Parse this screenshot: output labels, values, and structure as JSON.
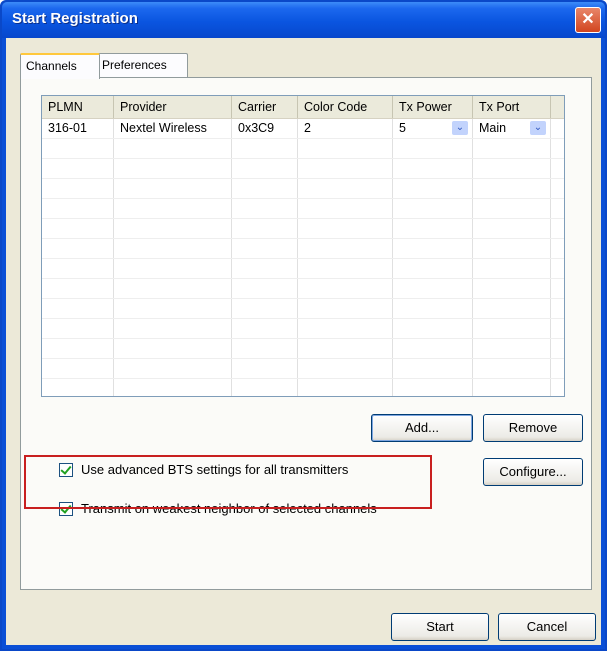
{
  "window": {
    "title": "Start Registration",
    "close_glyph": "✕"
  },
  "tabs": [
    {
      "label": "Channels",
      "active": true
    },
    {
      "label": "Preferences",
      "active": false
    }
  ],
  "table": {
    "columns": [
      "PLMN",
      "Provider",
      "Carrier",
      "Color Code",
      "Tx Power",
      "Tx Port"
    ],
    "rows": [
      [
        "316-01",
        "Nextel Wireless",
        "0x3C9",
        "2",
        "5",
        "Main"
      ]
    ],
    "dropdown_glyph": "⌄"
  },
  "buttons": {
    "add": "Add...",
    "remove": "Remove",
    "configure": "Configure...",
    "start": "Start",
    "cancel": "Cancel"
  },
  "options": {
    "advanced_bts": {
      "label": "Use advanced BTS settings for all transmitters",
      "checked": true
    },
    "weakest_neighbor": {
      "label": "Transmit on weakest neighbor of selected channels",
      "checked": true
    }
  },
  "colors": {
    "title_bar": "#0a55e0",
    "highlight": "#c81f1f",
    "dialog_bg": "#ece9d8"
  }
}
